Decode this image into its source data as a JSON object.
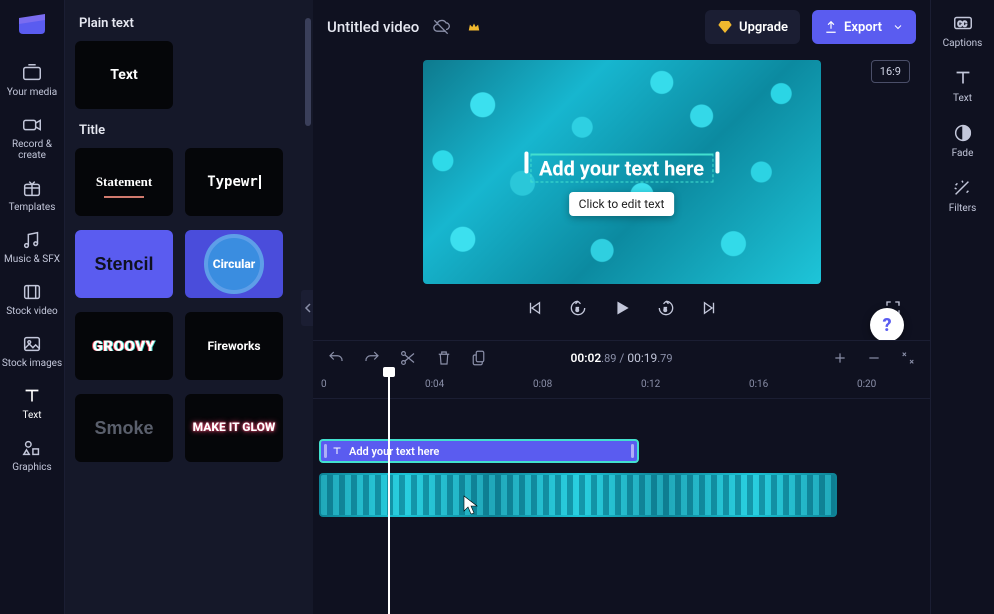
{
  "leftbar": {
    "items": [
      {
        "label": "Your media",
        "icon": "media"
      },
      {
        "label": "Record & create",
        "icon": "camera"
      },
      {
        "label": "Templates",
        "icon": "gift"
      },
      {
        "label": "Music & SFX",
        "icon": "music"
      },
      {
        "label": "Stock video",
        "icon": "film"
      },
      {
        "label": "Stock images",
        "icon": "image"
      },
      {
        "label": "Text",
        "icon": "text",
        "active": true
      },
      {
        "label": "Graphics",
        "icon": "shapes"
      }
    ]
  },
  "panel": {
    "section_plain": "Plain text",
    "section_title": "Title",
    "tiles": {
      "plain": "Text",
      "statement": "Statement",
      "typewr": "Typewr",
      "stencil": "Stencil",
      "circular": "Circular",
      "groovy": "GROOVY",
      "fireworks": "Fireworks",
      "smoke": "Smoke",
      "glow": "MAKE IT GLOW"
    }
  },
  "topbar": {
    "title": "Untitled video",
    "upgrade": "Upgrade",
    "export": "Export"
  },
  "preview": {
    "ratio": "16:9",
    "overlay_text": "Add your text here",
    "tooltip": "Click to edit text",
    "help": "?"
  },
  "timeline": {
    "elapsed": "00:02",
    "elapsed_frac": ".89",
    "total": "00:19",
    "total_frac": ".79",
    "ruler": [
      "0",
      "0:04",
      "0:08",
      "0:12",
      "0:16",
      "0:20"
    ],
    "text_clip_label": "Add your text here"
  },
  "rightbar": {
    "items": [
      {
        "label": "Captions",
        "icon": "cc"
      },
      {
        "label": "Text",
        "icon": "text"
      },
      {
        "label": "Fade",
        "icon": "circle-half"
      },
      {
        "label": "Filters",
        "icon": "sparkle"
      }
    ]
  }
}
